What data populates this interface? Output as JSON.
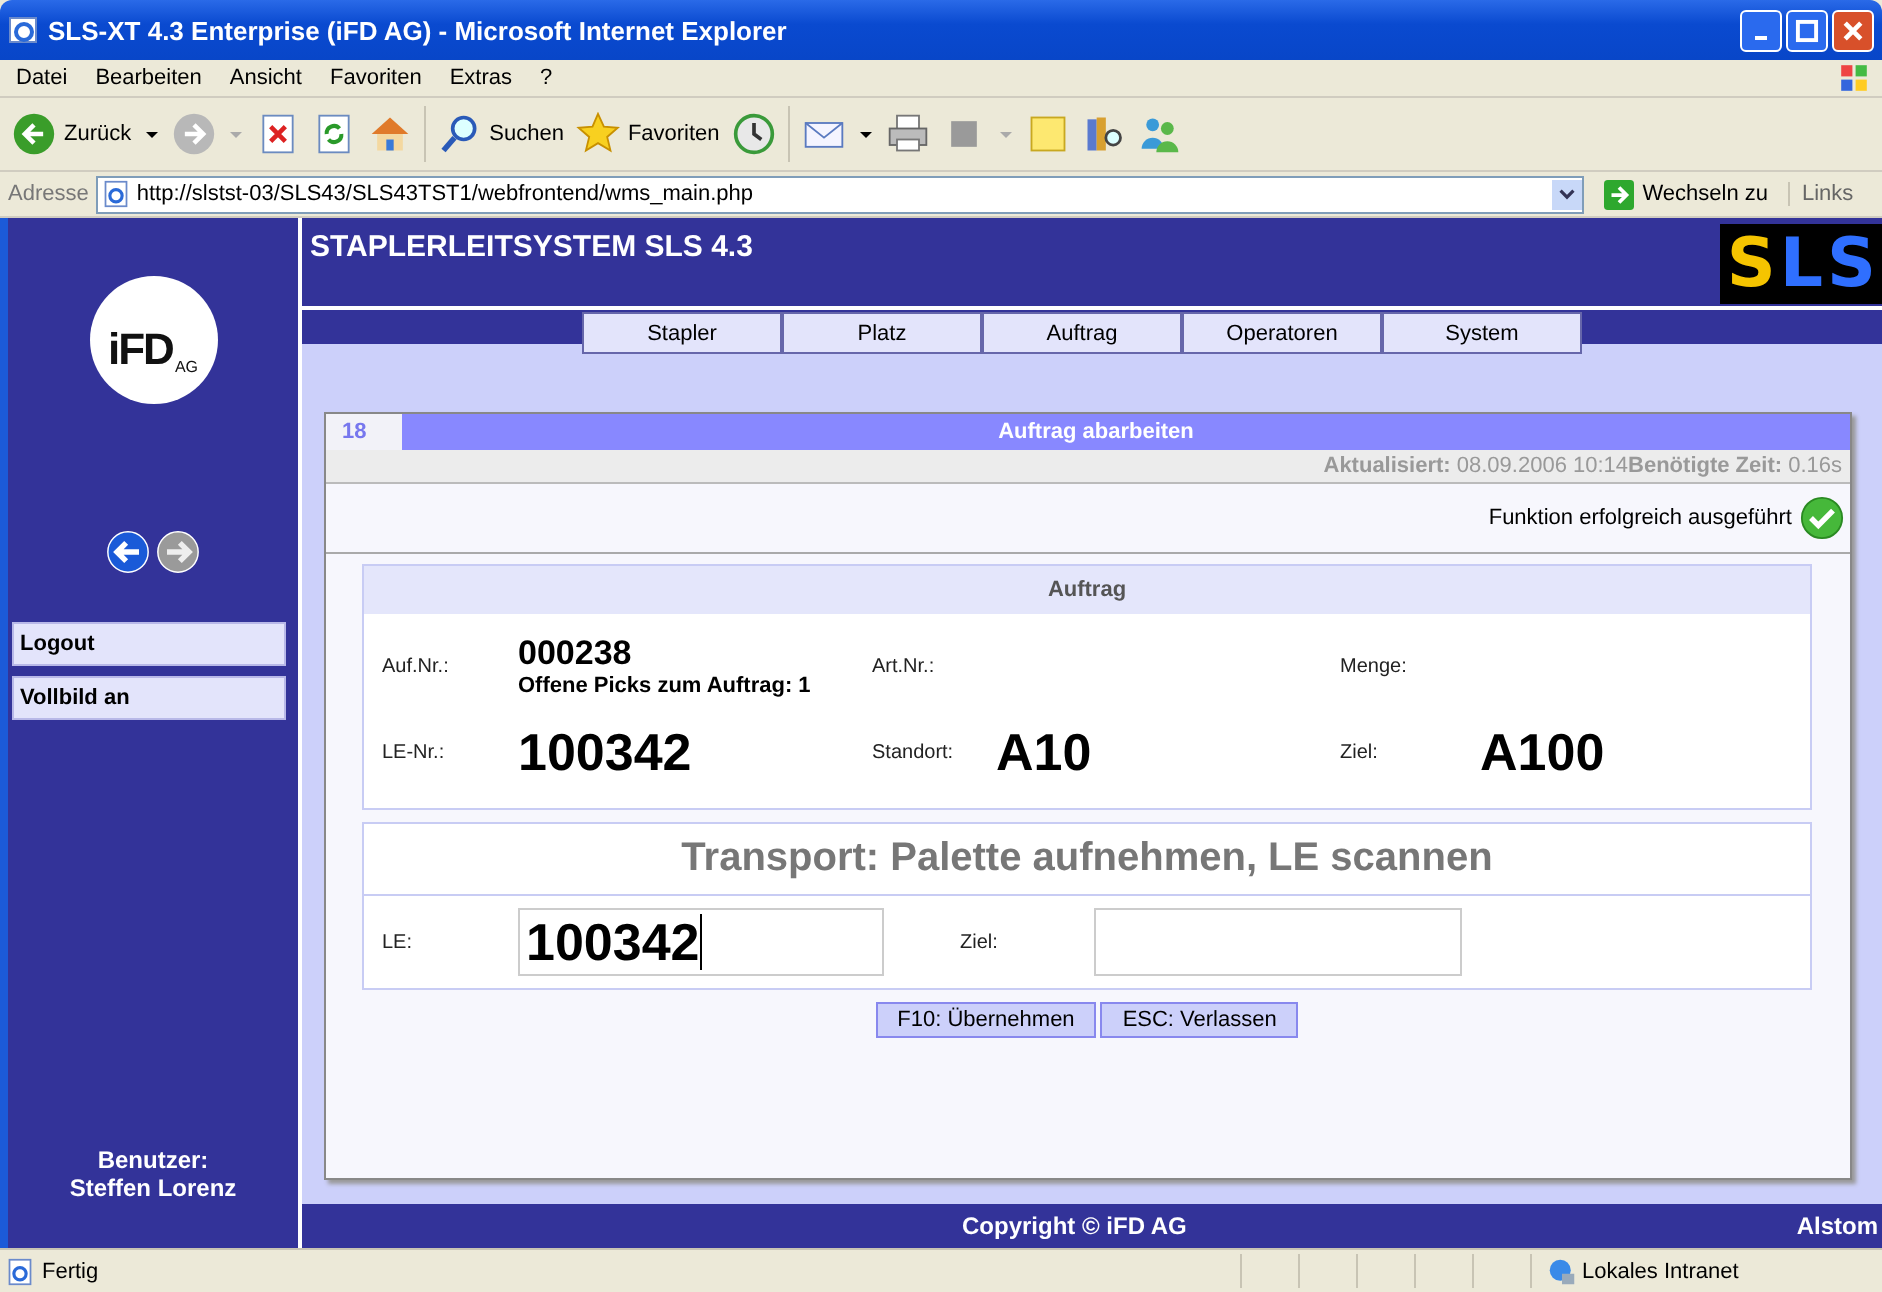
{
  "window": {
    "title": "SLS-XT 4.3 Enterprise (iFD AG) - Microsoft Internet Explorer"
  },
  "menu": [
    "Datei",
    "Bearbeiten",
    "Ansicht",
    "Favoriten",
    "Extras",
    "?"
  ],
  "toolbar": {
    "back_label": "Zurück",
    "search_label": "Suchen",
    "favorites_label": "Favoriten"
  },
  "address_bar": {
    "label": "Adresse",
    "url": "http://slstst-03/SLS43/SLS43TST1/webfrontend/wms_main.php",
    "go_label": "Wechseln zu",
    "links_label": "Links"
  },
  "header": {
    "logo": "iFD",
    "logo_suffix": "AG",
    "title": "STAPLERLEITSYSTEM SLS 4.3",
    "brand_letters": [
      {
        "letter": "S",
        "color": "#f5c400"
      },
      {
        "letter": "L",
        "color": "#2f6fff"
      },
      {
        "letter": "S",
        "color": "#2f6fff"
      }
    ]
  },
  "nav_tabs": [
    "Stapler",
    "Platz",
    "Auftrag",
    "Operatoren",
    "System"
  ],
  "sidebar": {
    "history_nav": [
      {
        "kind": "back",
        "disabled": false
      },
      {
        "kind": "forward",
        "disabled": true
      }
    ],
    "items": [
      "Logout",
      "Vollbild an"
    ],
    "user_label": "Benutzer:",
    "user_name": "Steffen Lorenz"
  },
  "panel": {
    "number": "18",
    "title": "Auftrag abarbeiten",
    "updated_label": "Aktualisiert:",
    "updated_value": "08.09.2006 10:14",
    "time_label": "Benötigte Zeit:",
    "time_value": "0.16s",
    "message": "Funktion erfolgreich ausgeführt",
    "order": {
      "heading": "Auftrag",
      "fields": [
        {
          "label": "Auf.Nr.:",
          "value": "000238",
          "note": "Offene Picks zum Auftrag: 1",
          "kind": "medium"
        },
        {
          "label": "Art.Nr.:"
        },
        {
          "label": "Menge:"
        },
        {
          "label": "LE-Nr.:",
          "value": "100342",
          "kind": "large"
        },
        {
          "label": "Standort:",
          "value": "A10",
          "kind": "large"
        },
        {
          "label": "Ziel:",
          "value": "A100",
          "kind": "large"
        }
      ]
    },
    "instruction": "Transport: Palette aufnehmen, LE scannen",
    "inputs": [
      {
        "label": "LE:",
        "value": "100342",
        "focused": true
      },
      {
        "label": "Ziel:",
        "focused": false
      }
    ],
    "buttons": [
      "F10: Übernehmen",
      "ESC: Verlassen"
    ]
  },
  "footer": {
    "copyright": "Copyright © iFD AG",
    "right_text": "Alstom"
  },
  "status_bar": {
    "text": "Fertig",
    "zone": "Lokales Intranet"
  }
}
